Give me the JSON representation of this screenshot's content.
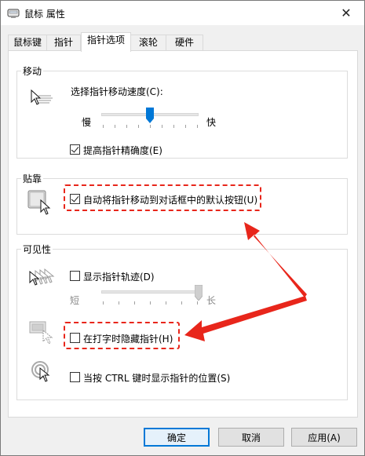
{
  "window": {
    "title": "鼠标 属性",
    "close_glyph": "✕"
  },
  "tabs": [
    {
      "label": "鼠标键",
      "active": false
    },
    {
      "label": "指针",
      "active": false
    },
    {
      "label": "指针选项",
      "active": true
    },
    {
      "label": "滚轮",
      "active": false
    },
    {
      "label": "硬件",
      "active": false
    }
  ],
  "motion": {
    "group_label": "移动",
    "speed_label": "选择指针移动速度(C):",
    "slow_label": "慢",
    "fast_label": "快",
    "speed_level": 0.5,
    "precision_label": "提高指针精确度(E)",
    "precision_checked": true
  },
  "snap": {
    "group_label": "贴靠",
    "snap_label": "自动将指针移动到对话框中的默认按钮(U)",
    "snap_checked": true
  },
  "visibility": {
    "group_label": "可见性",
    "trails_label": "显示指针轨迹(D)",
    "trails_checked": false,
    "short_label": "短",
    "long_label": "长",
    "trail_level": 1.0,
    "hide_label": "在打字时隐藏指针(H)",
    "hide_checked": false,
    "ctrl_label": "当按 CTRL 键时显示指针的位置(S)",
    "ctrl_checked": false
  },
  "buttons": {
    "ok": "确定",
    "cancel": "取消",
    "apply": "应用(A)"
  },
  "colors": {
    "annotation": "#e8261b",
    "accent": "#0078d7"
  }
}
